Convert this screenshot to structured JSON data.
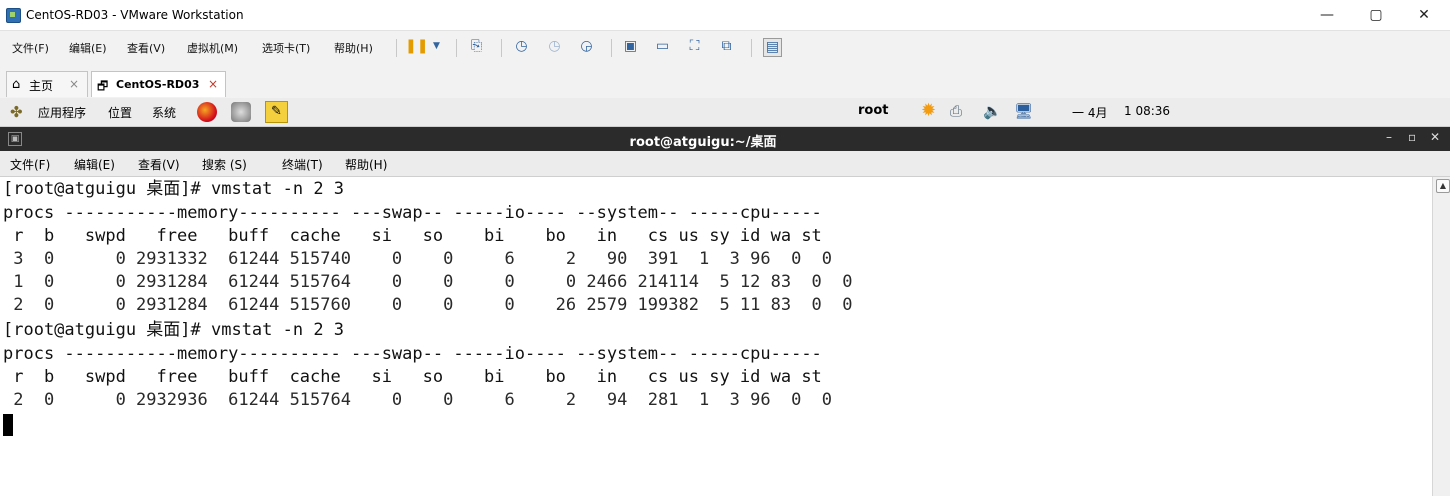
{
  "window": {
    "title": "CentOS-RD03 - VMware Workstation",
    "controls": [
      "—",
      "▢",
      "✕"
    ]
  },
  "vmware_menu": [
    "文件(F)",
    "编辑(E)",
    "查看(V)",
    "虚拟机(M)",
    "选项卡(T)",
    "帮助(H)"
  ],
  "tabs": [
    {
      "label": "主页",
      "close": "×"
    },
    {
      "label": "CentOS-RD03",
      "close": "×"
    }
  ],
  "gnome_panel": {
    "menus": [
      "应用程序",
      "位置",
      "系统"
    ],
    "user": "root",
    "date": "一 4月",
    "time": "1 08:36"
  },
  "terminal": {
    "title": "root@atguigu:~/桌面",
    "window_controls": [
      "–",
      "▫",
      "✕"
    ],
    "menu": [
      "文件(F)",
      "编辑(E)",
      "查看(V)",
      "搜索 (S)",
      "终端(T)",
      "帮助(H)"
    ],
    "lines": [
      "[root@atguigu 桌面]# vmstat -n 2 3",
      "procs -----------memory---------- ---swap-- -----io---- --system-- -----cpu-----",
      " r  b   swpd   free   buff  cache   si   so    bi    bo   in   cs us sy id wa st",
      " 3  0      0 2931332  61244 515740    0    0     6     2   90  391  1  3 96  0  0",
      " 1  0      0 2931284  61244 515764    0    0     0     0 2466 214114  5 12 83  0  0",
      " 2  0      0 2931284  61244 515760    0    0     0    26 2579 199382  5 11 83  0  0",
      "[root@atguigu 桌面]# vmstat -n 2 3",
      "procs -----------memory---------- ---swap-- -----io---- --system-- -----cpu-----",
      " r  b   swpd   free   buff  cache   si   so    bi    bo   in   cs us sy id wa st",
      " 2  0      0 2932936  61244 515764    0    0     6     2   94  281  1  3 96  0  0"
    ]
  }
}
